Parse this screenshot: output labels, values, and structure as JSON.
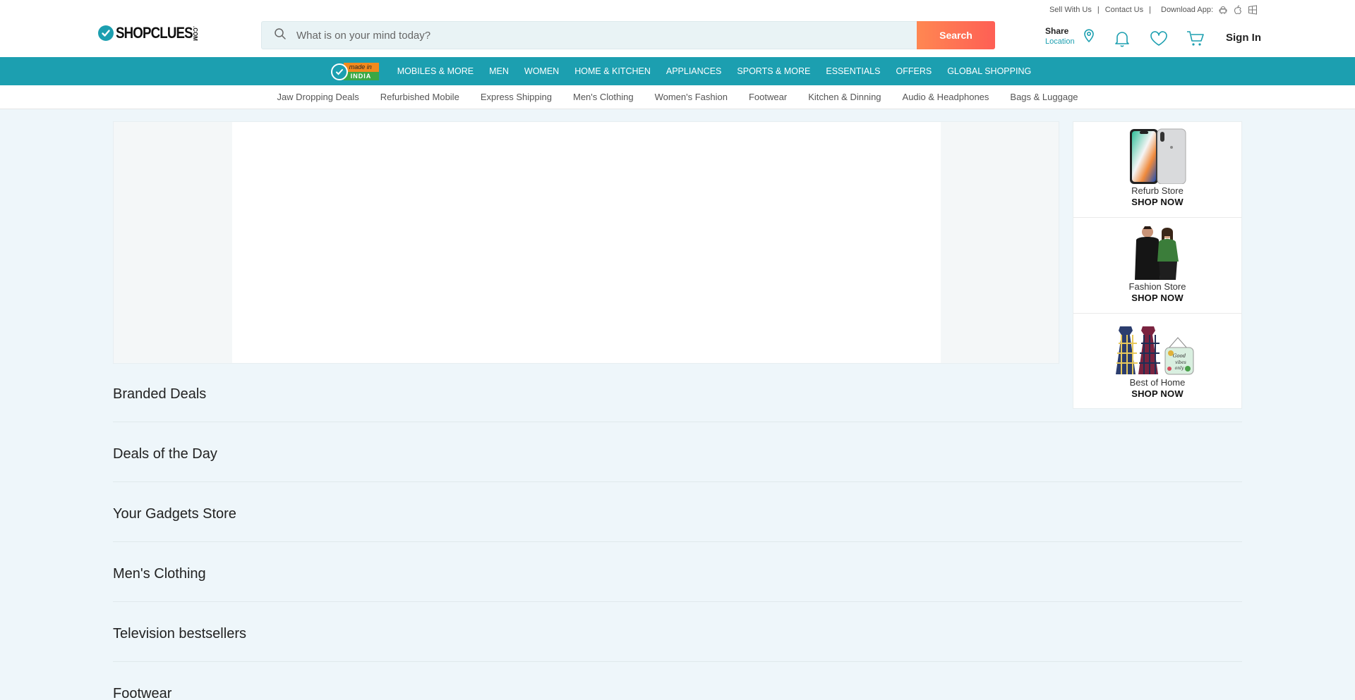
{
  "header": {
    "top_links": [
      "Sell With Us",
      "Contact Us"
    ],
    "download_label": "Download App:",
    "app_icons": [
      "android-icon",
      "apple-icon",
      "windows-icon"
    ],
    "logo_text": "SHOPCLUES",
    "logo_suffix": ".COM",
    "search": {
      "placeholder": "What is on your mind today?",
      "button_label": "Search"
    },
    "share_label": "Share",
    "location_label": "Location",
    "icons": [
      "location-pin-icon",
      "bell-icon",
      "heart-icon",
      "cart-icon"
    ],
    "signin_label": "Sign In"
  },
  "nav": {
    "badge_top": "made in",
    "badge_bottom": "INDIA",
    "items": [
      "MOBILES & MORE",
      "MEN",
      "WOMEN",
      "HOME & KITCHEN",
      "APPLIANCES",
      "SPORTS & MORE",
      "ESSENTIALS",
      "OFFERS",
      "GLOBAL SHOPPING"
    ]
  },
  "subnav": {
    "items": [
      "Jaw Dropping Deals",
      "Refurbished Mobile",
      "Express Shipping",
      "Men's Clothing",
      "Women's Fashion",
      "Footwear",
      "Kitchen & Dinning",
      "Audio & Headphones",
      "Bags & Luggage"
    ]
  },
  "sidebar": {
    "cards": [
      {
        "label": "Refurb Store",
        "cta": "SHOP NOW"
      },
      {
        "label": "Fashion Store",
        "cta": "SHOP NOW"
      },
      {
        "label": "Best of Home",
        "cta": "SHOP NOW"
      }
    ],
    "sign_text": "Good vibes only"
  },
  "sections": [
    "Branded Deals",
    "Deals of the Day",
    "Your Gadgets Store",
    "Men's Clothing",
    "Television bestsellers",
    "Footwear"
  ],
  "colors": {
    "brand": "#1c9fb0",
    "search_button": "#fe6f54",
    "page_bg": "#eef6fa"
  }
}
